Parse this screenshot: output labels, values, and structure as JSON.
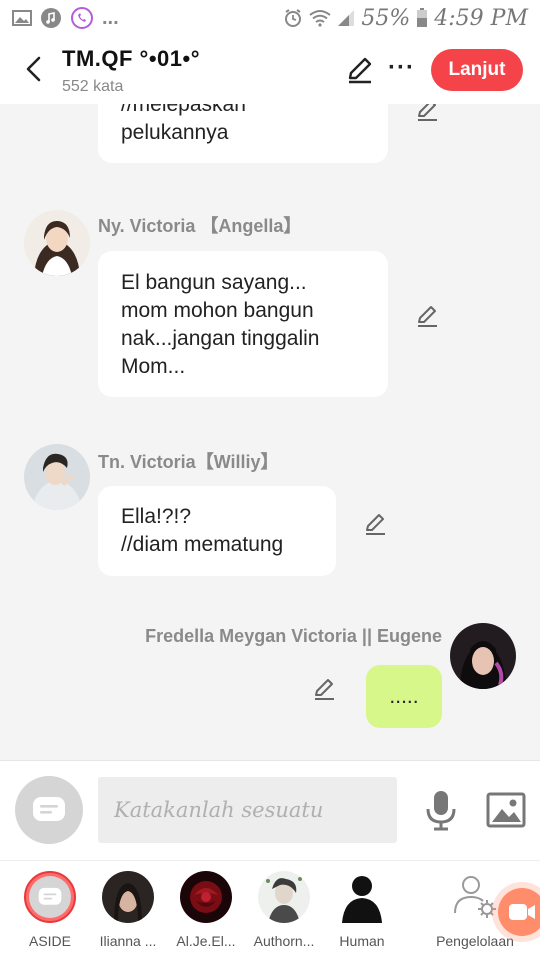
{
  "status": {
    "battery": "55%",
    "time": "4:59 PM",
    "more": "..."
  },
  "header": {
    "title": "TM.QF °•01•°",
    "subtitle": "552 kata",
    "more": "···",
    "continue_label": "Lanjut"
  },
  "messages": [
    {
      "text": "//melepaskan\npelukannya"
    },
    {
      "sender": "Ny. Victoria 【Angella】",
      "text": "El bangun sayang...\nmom mohon bangun\nnak...jangan tinggalin\nMom..."
    },
    {
      "sender": "Tn. Victoria【Williy】",
      "text": "Ella!?!?\n//diam mematung"
    },
    {
      "sender": "Fredella Meygan Victoria || Eugene",
      "text": "....."
    }
  ],
  "input": {
    "placeholder": "Katakanlah sesuatu"
  },
  "characters": [
    {
      "label": "ASIDE"
    },
    {
      "label": "Ilianna ..."
    },
    {
      "label": "Al.Je.El..."
    },
    {
      "label": "Authorn..."
    },
    {
      "label": "Human"
    },
    {
      "label": "Pengelolaan"
    }
  ],
  "colors": {
    "accent": "#f44349",
    "own_bubble": "#d8f78a",
    "background": "#f4f4f4"
  }
}
